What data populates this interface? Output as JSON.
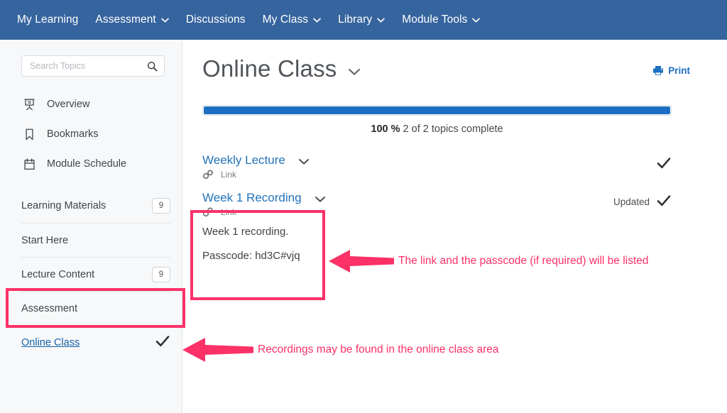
{
  "topnav": {
    "items": [
      {
        "label": "My Learning",
        "has_dropdown": false
      },
      {
        "label": "Assessment",
        "has_dropdown": true
      },
      {
        "label": "Discussions",
        "has_dropdown": false
      },
      {
        "label": "My Class",
        "has_dropdown": true
      },
      {
        "label": "Library",
        "has_dropdown": true
      },
      {
        "label": "Module Tools",
        "has_dropdown": true
      }
    ],
    "background": "#36649e"
  },
  "sidebar": {
    "search": {
      "placeholder": "Search Topics",
      "value": "",
      "icon": "search-icon"
    },
    "links": [
      {
        "label": "Overview",
        "icon": "presentation-screen-icon"
      },
      {
        "label": "Bookmarks",
        "icon": "bookmark-icon"
      },
      {
        "label": "Module Schedule",
        "icon": "calendar-icon"
      }
    ],
    "units": [
      {
        "label": "Learning Materials",
        "badge": "9",
        "selected": false
      },
      {
        "label": "Start Here",
        "badge": "",
        "selected": false
      },
      {
        "label": "Lecture Content",
        "badge": "9",
        "selected": false
      },
      {
        "label": "Assessment",
        "badge": "",
        "selected": false
      },
      {
        "label": "Online Class",
        "badge": "",
        "selected": true,
        "completed_icon": "checkmark-icon"
      }
    ]
  },
  "main": {
    "title": "Online Class",
    "title_dropdown_icon": "chevron-down-icon",
    "print": {
      "label": "Print",
      "icon": "printer-icon",
      "color": "#1b6ec2"
    },
    "progress": {
      "percent_label": "100 %",
      "percent_value": 100,
      "detail": "2 of 2 topics complete",
      "fill_color": "#1b6ec2"
    },
    "topics": [
      {
        "title": "Weekly Lecture",
        "type_label": "Link",
        "type_icon": "chain-link-icon",
        "dropdown_icon": "chevron-down-icon",
        "description": "",
        "passcode": "",
        "status_text": "",
        "status_icon": "checkmark-icon"
      },
      {
        "title": "Week 1 Recording",
        "type_label": "Link",
        "type_icon": "chain-link-icon",
        "dropdown_icon": "chevron-down-icon",
        "description": "Week 1 recording.",
        "passcode": "Passcode: hd3C#vjq",
        "status_text": "Updated",
        "status_icon": "checkmark-icon"
      }
    ]
  },
  "annotations": {
    "color": "#fb3168",
    "items": [
      {
        "text": "The link and the passcode (if required) will be listed",
        "arrow": "arrow-left-icon"
      },
      {
        "text": "Recordings may be found in the online class area",
        "arrow": "arrow-left-icon"
      }
    ]
  }
}
